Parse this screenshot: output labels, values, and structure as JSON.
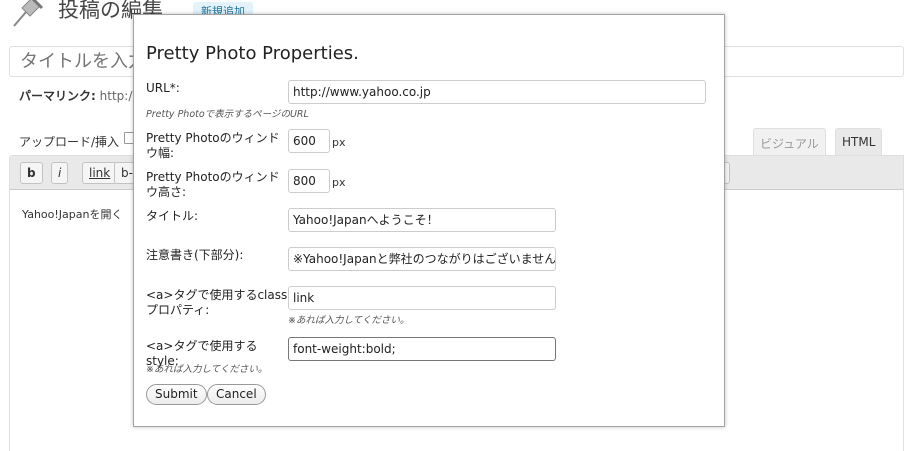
{
  "page": {
    "title": "投稿の編集",
    "add_new": "新規追加",
    "title_placeholder": "タイトルを入力",
    "permalink_label": "パーマリンク:",
    "permalink_url": "http:/",
    "upload_label": "アップロード/挿入",
    "tabs": {
      "visual": "ビジュアル",
      "html": "HTML"
    },
    "quicktags": [
      "b",
      "i",
      "link",
      "b-q"
    ],
    "editor_text": "Yahoo!Japanを開く"
  },
  "dialog": {
    "title": "Pretty Photo Properties.",
    "fields": {
      "url": {
        "label": "URL*:",
        "value": "http://www.yahoo.co.jp",
        "note": "Pretty Photoで表示するページのURL"
      },
      "width": {
        "label": "Pretty Photoのウィンドウ幅:",
        "value": "600",
        "unit": "px"
      },
      "height": {
        "label": "Pretty Photoのウィンドウ高さ:",
        "value": "800",
        "unit": "px"
      },
      "title": {
        "label": "タイトル:",
        "value": "Yahoo!Japanへようこそ！"
      },
      "note": {
        "label": "注意書き(下部分):",
        "value": "※Yahoo!Japanと弊社のつながりはございません"
      },
      "class": {
        "label": "<a>タグで使用するclassプロパティ:",
        "value": "link",
        "note": "※あれば入力してください。"
      },
      "style": {
        "label": "<a>タグで使用するstyle:",
        "value": "font-weight:bold;",
        "note": "※あれば入力してください。"
      }
    },
    "buttons": {
      "submit": "Submit",
      "cancel": "Cancel"
    }
  },
  "icons": {
    "page_icon": "pushpin-icon",
    "media_icon": "media-upload-icon"
  }
}
